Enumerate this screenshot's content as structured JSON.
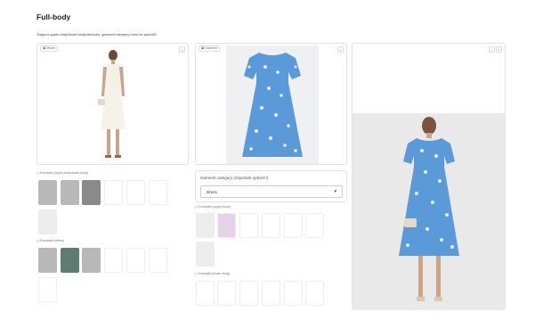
{
  "header": {
    "title": "Full-body",
    "subtitle": "Support upper-body/lower-body/dresses; garment category must be paired!!!"
  },
  "model_panel": {
    "label": "Model"
  },
  "garment_panel": {
    "label": "Garment"
  },
  "examples": {
    "upper_full": "Examples (upper-body/lower-body)",
    "dress": "Examples (dress)",
    "upper_garment": "Examples (upper-body)",
    "lower_garment": "Examples (lower-body)"
  },
  "category": {
    "label": "Garment category (important option!!!)",
    "value": "Dress"
  },
  "icons": {
    "model_badge": "image-icon",
    "garment_badge": "image-icon",
    "dropdown": "chevron-down-icon",
    "examples": "chip-icon"
  },
  "colors": {
    "dress_blue": "#5b9ad8",
    "accent": "#f97316"
  }
}
